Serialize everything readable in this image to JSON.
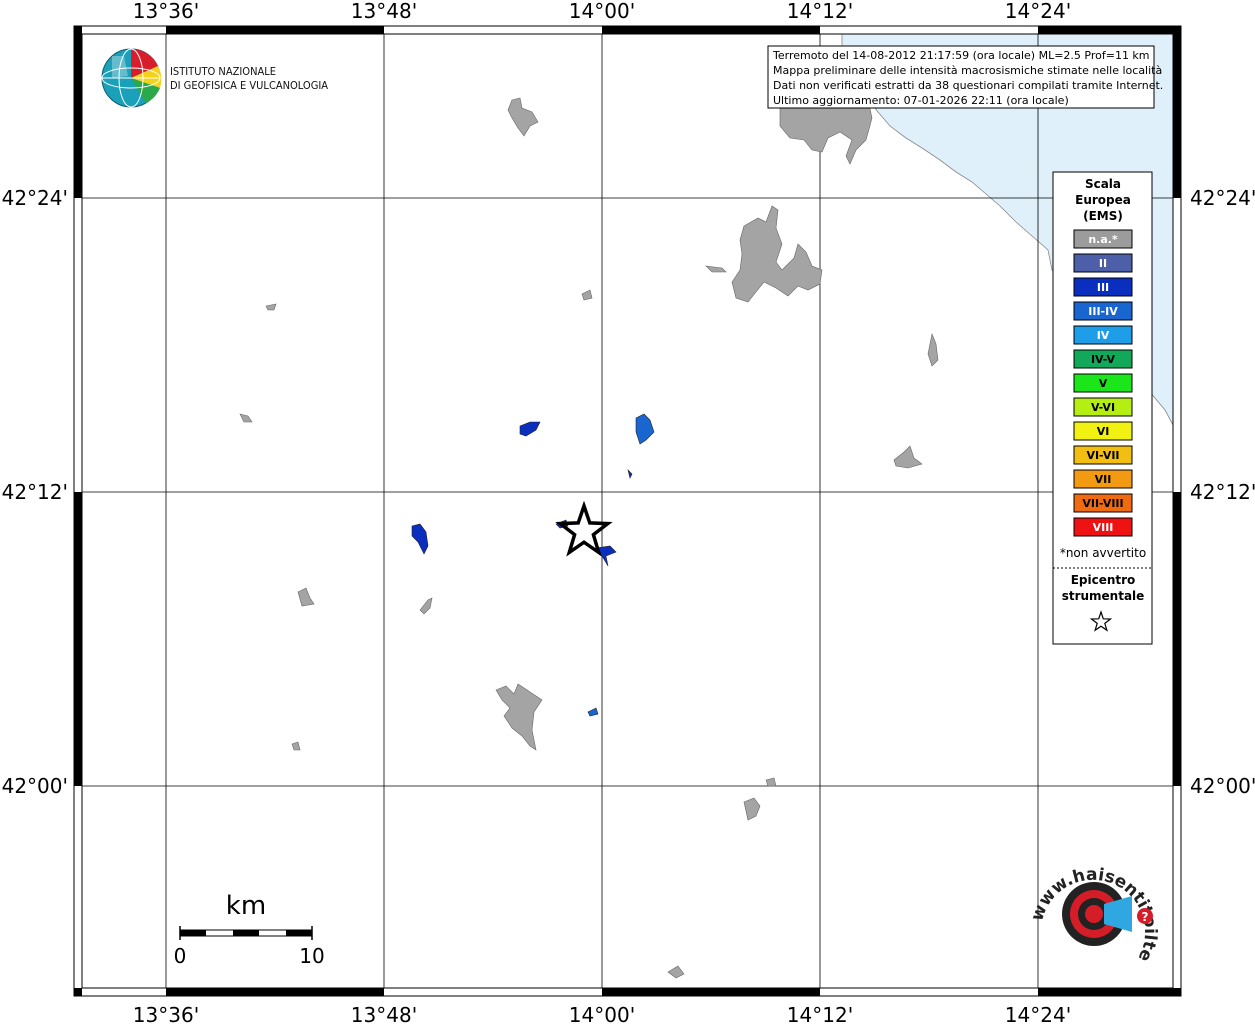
{
  "map": {
    "lon_ticks": [
      "13°36'",
      "13°48'",
      "14°00'",
      "14°12'",
      "14°24'"
    ],
    "lat_ticks": [
      "42°24'",
      "42°12'",
      "42°00'"
    ]
  },
  "info_box": {
    "lines": [
      "Terremoto del 14-08-2012 21:17:59 (ora locale) ML=2.5 Prof=11 km",
      "Mappa preliminare delle intensità macrosismiche stimate nelle località",
      "Dati non verificati estratti da 38 questionari compilati tramite Internet.",
      "Ultimo aggiornamento: 07-01-2026 22:11 (ora locale)"
    ]
  },
  "institute": {
    "line1": "ISTITUTO NAZIONALE",
    "line2": "DI GEOFISICA E VULCANOLOGIA"
  },
  "legend": {
    "title": [
      "Scala",
      "Europea",
      "(EMS)"
    ],
    "items": [
      {
        "label": "n.a.*",
        "color": "#9c9c9c",
        "text_color": "#ffffff"
      },
      {
        "label": "II",
        "color": "#4c5fa8",
        "text_color": "#ffffff"
      },
      {
        "label": "III",
        "color": "#0a2fbf",
        "text_color": "#ffffff"
      },
      {
        "label": "III-IV",
        "color": "#1a66d0",
        "text_color": "#ffffff"
      },
      {
        "label": "IV",
        "color": "#1e9ee8",
        "text_color": "#ffffff"
      },
      {
        "label": "IV-V",
        "color": "#12a85a",
        "text_color": "#000000"
      },
      {
        "label": "V",
        "color": "#1ae61a",
        "text_color": "#000000"
      },
      {
        "label": "V-VI",
        "color": "#b4ee12",
        "text_color": "#000000"
      },
      {
        "label": "VI",
        "color": "#f2f212",
        "text_color": "#000000"
      },
      {
        "label": "VI-VII",
        "color": "#f2be12",
        "text_color": "#000000"
      },
      {
        "label": "VII",
        "color": "#f29a12",
        "text_color": "#000000"
      },
      {
        "label": "VII-VIII",
        "color": "#f06a12",
        "text_color": "#000000"
      },
      {
        "label": "VIII",
        "color": "#ee1212",
        "text_color": "#ffffff"
      }
    ],
    "note": "*non avvertito",
    "epicenter_label": [
      "Epicentro",
      "strumentale"
    ]
  },
  "scale_bar": {
    "unit": "km",
    "min_label": "0",
    "max_label": "10"
  },
  "watermark": {
    "text": "www.haisentitoilterremoto.it"
  },
  "colors": {
    "sea": "#dff0fb",
    "settlement_gray": "#a4a4a4",
    "intensity_blue": "#0a2fbf",
    "intensity_lightblue": "#1a66d0"
  }
}
